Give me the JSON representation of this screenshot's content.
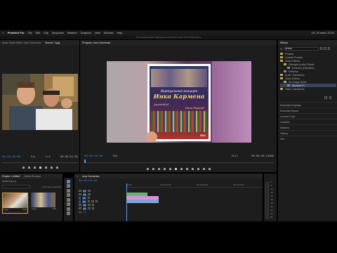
{
  "menubar": {
    "app": "Premiere Pro",
    "items": [
      "File",
      "Edit",
      "Clip",
      "Sequence",
      "Markers",
      "Graphics",
      "View",
      "Window",
      "Help"
    ],
    "path": "/Пользователи/artem/Документы/Adobe/Premiere Pro/Untitled.prproj",
    "clock": "Сб, 20 нояб. 22:23"
  },
  "source_panel": {
    "tabs": [
      "Audio Track Mixer: Inca Carmenas",
      "Source: 1.jpg"
    ],
    "timecode_left": "00:00:00:00",
    "fit_label": "Fit",
    "quality": "1/2",
    "timecode_right": "00:00:04:29"
  },
  "program_panel": {
    "title": "Program: Inca Carmenas",
    "timecode_left": "00:00:00:00",
    "zoom": "75%",
    "quality": "Full",
    "timecode_right": "00:00:40:13360",
    "poster_text": {
      "top": "Виртуальный концерт",
      "name": "Инка Кармена",
      "sub": "Ansamblul",
      "sub2": "Dans Popular",
      "year": "2021"
    }
  },
  "project_panel": {
    "tabs": [
      "Project: Untitled",
      "Media Browser"
    ],
    "file": "Untitled.prproj",
    "count": "1 of 4 items selected",
    "items": [
      {
        "name": "1.jpg",
        "duration": "4:29"
      },
      {
        "name": "2.jpg",
        "duration": "4:29"
      }
    ]
  },
  "timeline_panel": {
    "title": "Inca Carmenas",
    "timecode": "00:00:00:00",
    "ruler": [
      "00:00",
      "00:00:15:00",
      "00:00:30:00",
      "00:00:45:00"
    ],
    "tracks": [
      {
        "id": "V3",
        "label": "V3"
      },
      {
        "id": "V2",
        "label": "V2"
      },
      {
        "id": "V1",
        "label": "V1"
      },
      {
        "id": "A1",
        "label": "A1"
      },
      {
        "id": "A2",
        "label": "A2"
      },
      {
        "id": "A3",
        "label": "A3"
      },
      {
        "id": "Mix",
        "label": "Mix"
      }
    ],
    "mix_value": "0.0",
    "meter_labels": [
      "0",
      "-6",
      "-12",
      "-18",
      "-24",
      "-30",
      "-36",
      "-42",
      "-48",
      "-54",
      "dB"
    ]
  },
  "effects_panel": {
    "title": "Effects",
    "search_value": "dennis",
    "tree": [
      {
        "label": "Presets",
        "kind": "folder",
        "indent": 0
      },
      {
        "label": "Lumetri Presets",
        "kind": "folder",
        "indent": 0
      },
      {
        "label": "Audio Effects",
        "kind": "folder",
        "indent": 0
      },
      {
        "label": "Obsolete Audio Effects",
        "kind": "folder",
        "indent": 1
      },
      {
        "label": "DeNoise (Obsolete)",
        "kind": "fx",
        "indent": 2
      },
      {
        "label": "DeNoise",
        "kind": "fx",
        "indent": 1
      },
      {
        "label": "Audio Transitions",
        "kind": "folder",
        "indent": 0
      },
      {
        "label": "Video Effects",
        "kind": "folder",
        "indent": 0
      },
      {
        "label": "3D Image Bullet",
        "kind": "folder",
        "indent": 1
      },
      {
        "label": "Remove Fl...",
        "kind": "fx",
        "indent": 2
      },
      {
        "label": "Video Transitions",
        "kind": "folder",
        "indent": 0
      }
    ],
    "sections": [
      "Essential Graphics",
      "Essential Sound",
      "Lumetri Color",
      "Libraries",
      "Markers",
      "History",
      "Info"
    ]
  },
  "colors": {
    "accent": "#3a8fe0",
    "video_clip": "#d78fe0",
    "audio_clip": "#7aa6d4",
    "folder": "#c7a64f",
    "playhead": "#5a9be6"
  }
}
